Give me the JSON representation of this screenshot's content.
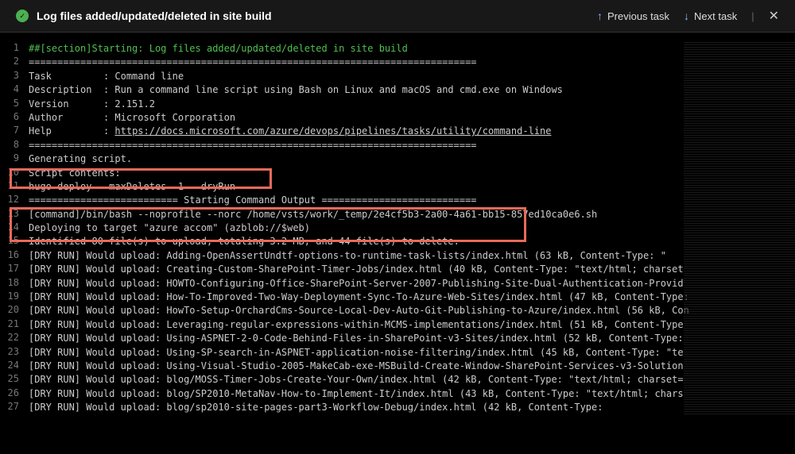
{
  "header": {
    "title": "Log files added/updated/deleted in site build",
    "prev": "Previous task",
    "next": "Next task"
  },
  "rule": "==============================================================================",
  "log": {
    "r1": "##[section]Starting: Log files added/updated/deleted in site build",
    "r3a": "Task",
    "r3b": ": Command line",
    "r4a": "Description",
    "r4b": ": Run a command line script using Bash on Linux and macOS and cmd.exe on Windows",
    "r5a": "Version",
    "r5b": ": 2.151.2",
    "r6a": "Author",
    "r6b": ": Microsoft Corporation",
    "r7a": "Help",
    "r7b": ": ",
    "r7link": "https://docs.microsoft.com/azure/devops/pipelines/tasks/utility/command-line",
    "r9": "Generating script.",
    "r10": "Script contents:",
    "r11": "hugo deploy --maxDeletes -1 --dryRun",
    "r12": "========================== Starting Command Output ===========================",
    "r13": "[command]/bin/bash --noprofile --norc /home/vsts/work/_temp/2e4cf5b3-2a00-4a61-bb15-857ed10ca0e6.sh",
    "r14": "Deploying to target \"azure accom\" (azblob://$web)",
    "r15": "Identified 80 file(s) to upload, totaling 3.2 MB, and 44 file(s) to delete.",
    "r16": "[DRY RUN] Would upload: Adding-OpenAssertUndtf-options-to-runtime-task-lists/index.html (63 kB, Content-Type: \"",
    "r17": "[DRY RUN] Would upload: Creating-Custom-SharePoint-Timer-Jobs/index.html (40 kB, Content-Type: \"text/html; charset",
    "r18": "[DRY RUN] Would upload: HOWTO-Configuring-Office-SharePoint-Server-2007-Publishing-Site-Dual-Authentication-Provid",
    "r19": "[DRY RUN] Would upload: How-To-Improved-Two-Way-Deployment-Sync-To-Azure-Web-Sites/index.html (47 kB, Content-Type:",
    "r20": "[DRY RUN] Would upload: HowTo-Setup-OrchardCms-Source-Local-Dev-Auto-Git-Publishing-to-Azure/index.html (56 kB, Con",
    "r21": "[DRY RUN] Would upload: Leveraging-regular-expressions-within-MCMS-implementations/index.html (51 kB, Content-Type",
    "r22": "[DRY RUN] Would upload: Using-ASPNET-2-0-Code-Behind-Files-in-SharePoint-v3-Sites/index.html (52 kB, Content-Type:",
    "r23": "[DRY RUN] Would upload: Using-SP-search-in-ASPNET-application-noise-filtering/index.html (45 kB, Content-Type: \"te",
    "r24": "[DRY RUN] Would upload: Using-Visual-Studio-2005-MakeCab-exe-MSBuild-Create-Window-SharePoint-Services-v3-Solution",
    "r25": "[DRY RUN] Would upload: blog/MOSS-Timer-Jobs-Create-Your-Own/index.html (42 kB, Content-Type: \"text/html; charset=",
    "r26": "[DRY RUN] Would upload: blog/SP2010-MetaNav-How-to-Implement-It/index.html (43 kB, Content-Type: \"text/html; chars",
    "r27": "[DRY RUN] Would upload: blog/sp2010-site-pages-part3-Workflow-Debug/index.html (42 kB, Content-Type:"
  }
}
